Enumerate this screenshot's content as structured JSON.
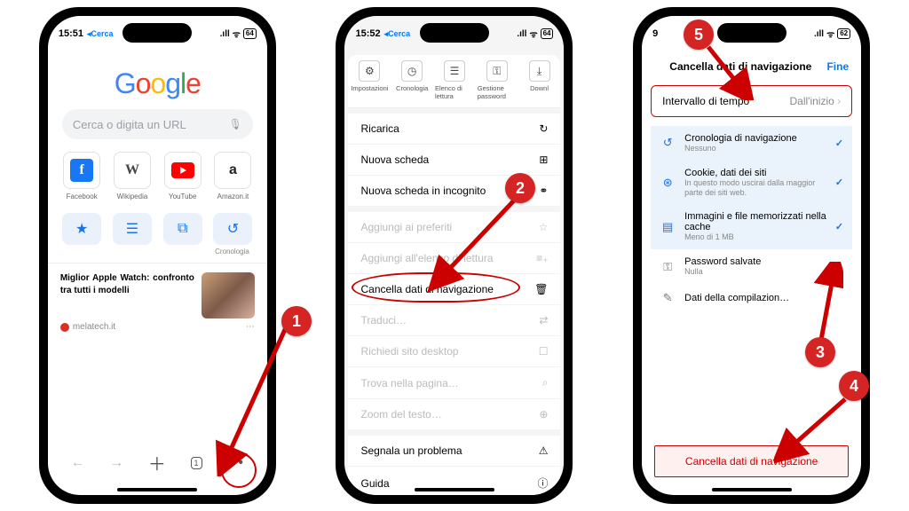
{
  "status": {
    "time1": "15:51",
    "time2": "15:52",
    "back": "Cerca",
    "batt1": "64",
    "batt2": "64",
    "batt3": "62",
    "sig": ".ıll",
    "wifi": "⋐"
  },
  "p1": {
    "search_placeholder": "Cerca o digita un URL",
    "shortcuts": [
      "Facebook",
      "Wikipedia",
      "YouTube",
      "Amazon.it"
    ],
    "cronologia": "Cronologia",
    "news_title": "Miglior Apple Watch: confronto tra tutti i modelli",
    "news_src": "melatech.it"
  },
  "p2": {
    "top": [
      "Impostazioni",
      "Cronologia",
      "Elenco di lettura",
      "Gestione password",
      "Downl"
    ],
    "items": {
      "ricarica": "Ricarica",
      "nscheda": "Nuova scheda",
      "nincognito": "Nuova scheda in incognito",
      "fav": "Aggiungi ai preferiti",
      "elett": "Aggiungi all'elenco di lettura",
      "cancella": "Cancella dati di navigazione",
      "traduci": "Traduci…",
      "desktop": "Richiedi sito desktop",
      "trova": "Trova nella pagina…",
      "zoom": "Zoom del testo…",
      "segnala": "Segnala un problema",
      "guida": "Guida"
    }
  },
  "p3": {
    "title": "Cancella dati di navigazione",
    "fine": "Fine",
    "interval_label": "Intervallo di tempo",
    "interval_value": "Dall'inizio",
    "opts": {
      "cron": {
        "t": "Cronologia di navigazione",
        "s": "Nessuno"
      },
      "cookie": {
        "t": "Cookie, dati dei siti",
        "s": "In questo modo uscirai dalla maggior parte dei siti web."
      },
      "cache": {
        "t": "Immagini e file memorizzati nella cache",
        "s": "Meno di 1 MB"
      },
      "pwd": {
        "t": "Password salvate",
        "s": "Nulla"
      },
      "comp": {
        "t": "Dati della compilazion…",
        "s": ""
      }
    },
    "clear": "Cancella dati di navigazione"
  },
  "badges": {
    "1": "1",
    "2": "2",
    "3": "3",
    "4": "4",
    "5": "5"
  }
}
